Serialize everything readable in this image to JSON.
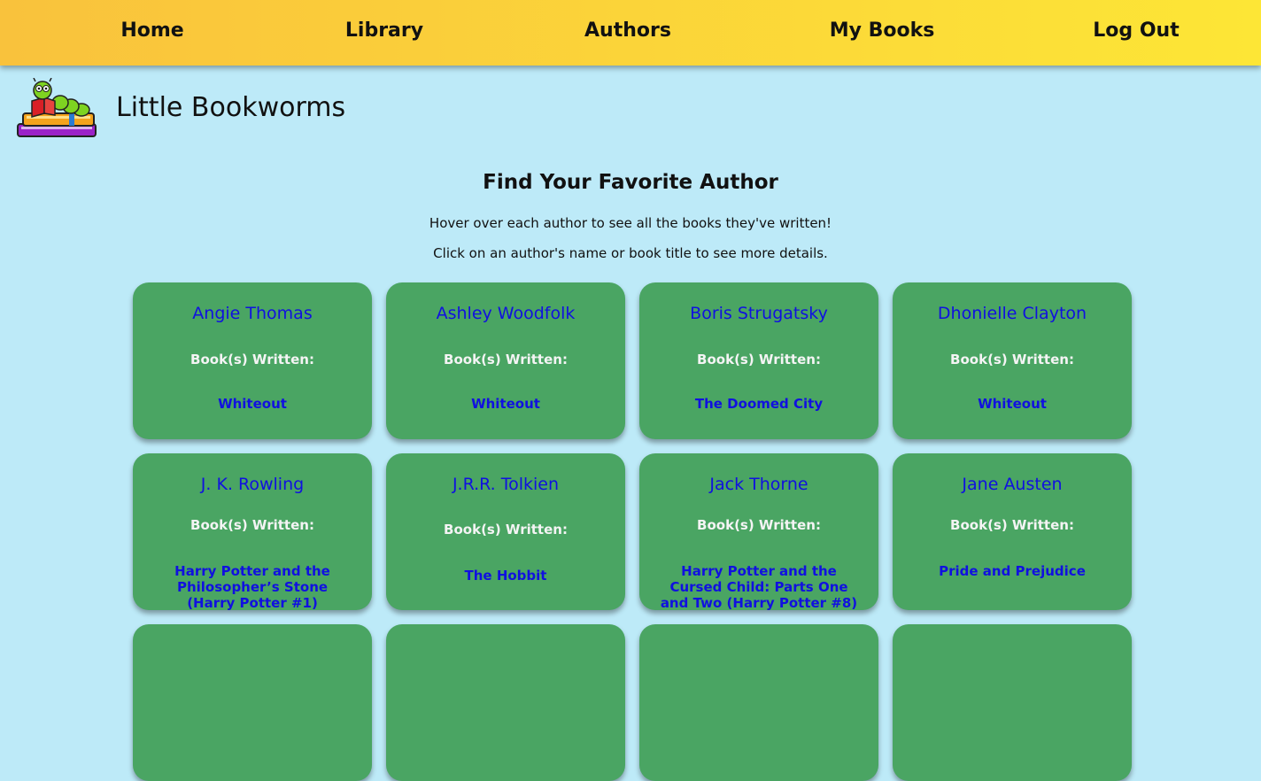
{
  "nav": {
    "home": "Home",
    "library": "Library",
    "authors": "Authors",
    "my_books": "My Books",
    "log_out": "Log Out"
  },
  "site": {
    "title": "Little Bookworms",
    "logo_icon": "bookworm-on-books-icon"
  },
  "main": {
    "heading": "Find Your Favorite Author",
    "instruction_1": "Hover over each author to see all the books they've written!",
    "instruction_2": "Click on an author's name or book title to see more details."
  },
  "colors": {
    "background": "#bdeaf8",
    "card": "#4aa563",
    "link": "#1010e0",
    "nav_gradient_start": "#f9c23c",
    "nav_gradient_end": "#fde636"
  },
  "authors": [
    {
      "name": "Angie Thomas",
      "label": "Book(s) Written:",
      "book": "Whiteout"
    },
    {
      "name": "Ashley Woodfolk",
      "label": "Book(s) Written:",
      "book": "Whiteout"
    },
    {
      "name": "Boris Strugatsky",
      "label": "Book(s) Written:",
      "book": "The Doomed City"
    },
    {
      "name": "Dhonielle Clayton",
      "label": "Book(s) Written:",
      "book": "Whiteout"
    },
    {
      "name": "J. K. Rowling",
      "label": "Book(s) Written:",
      "book": "Harry Potter and the Philosopher’s Stone (Harry Potter #1)"
    },
    {
      "name": "J.R.R. Tolkien",
      "label": "Book(s) Written:",
      "book": "The Hobbit"
    },
    {
      "name": "Jack Thorne",
      "label": "Book(s) Written:",
      "book": "Harry Potter and the Cursed Child: Parts One and Two (Harry Potter #8)"
    },
    {
      "name": "Jane Austen",
      "label": "Book(s) Written:",
      "book": "Pride and Prejudice"
    }
  ]
}
